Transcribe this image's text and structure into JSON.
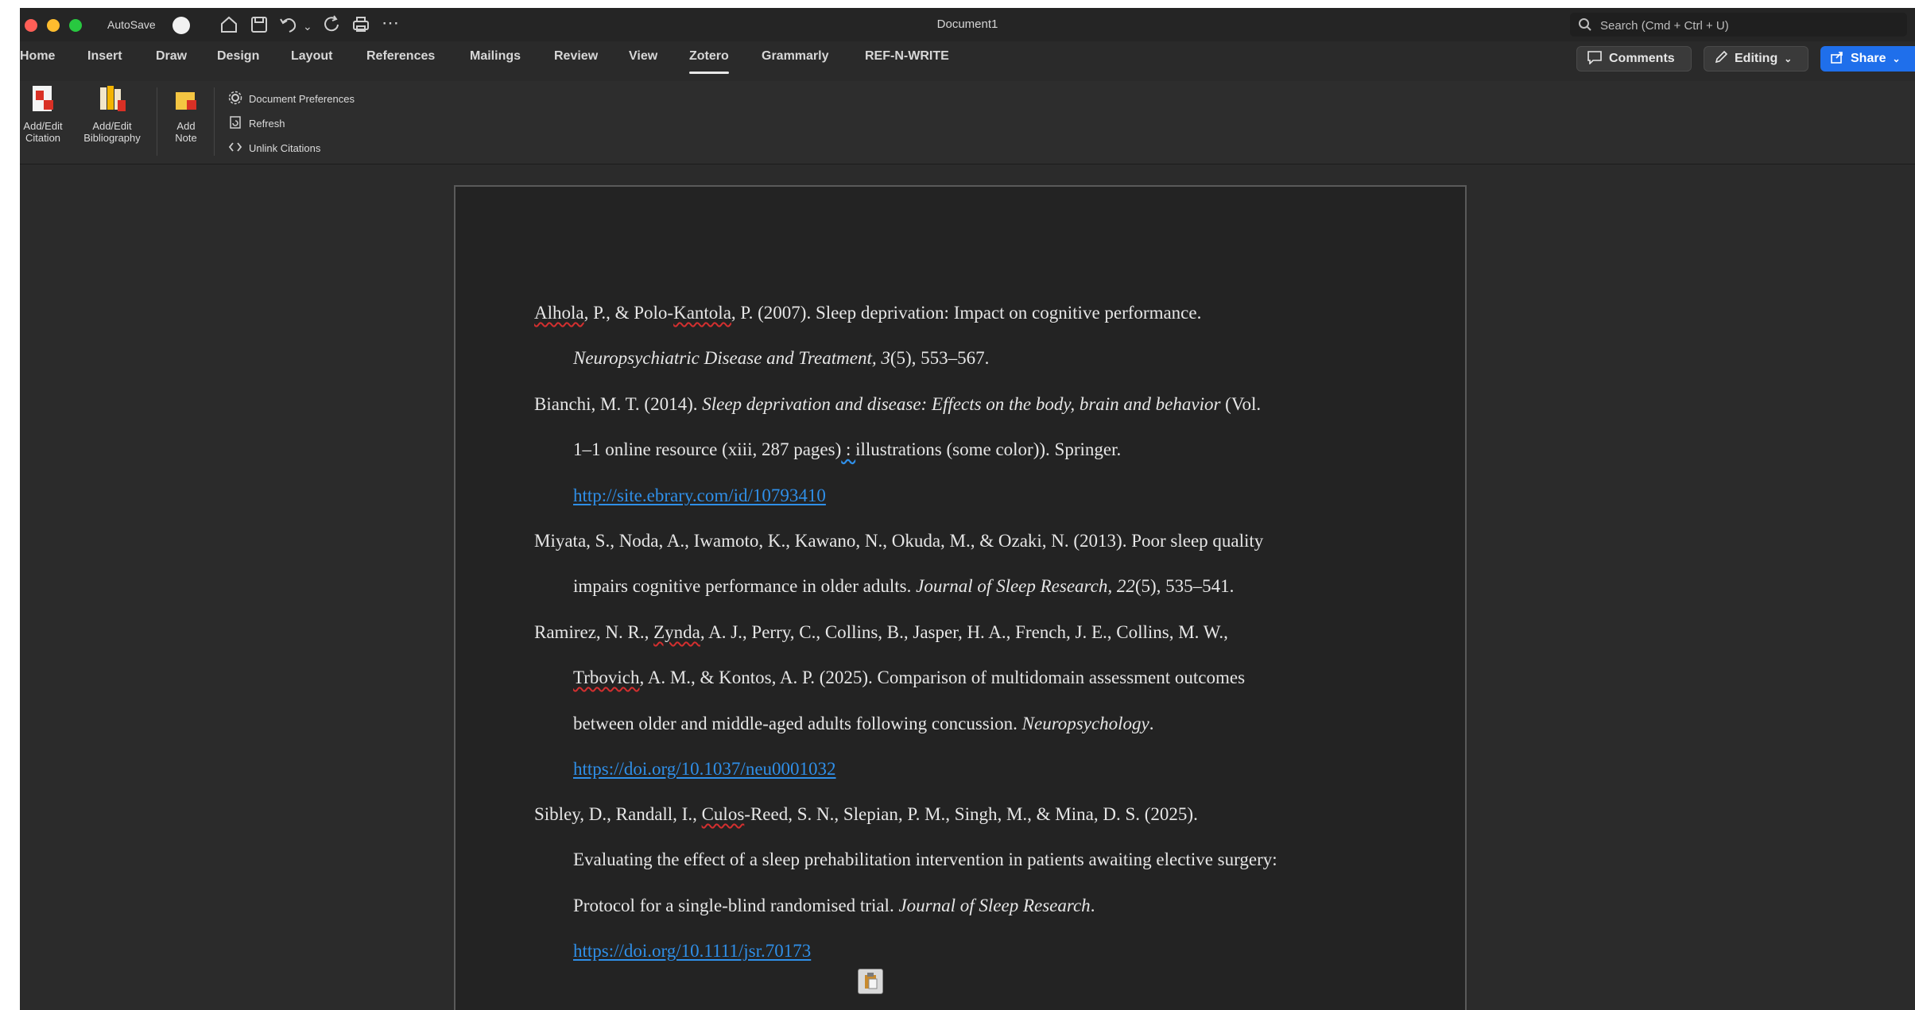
{
  "window": {
    "title": "Document1",
    "autosave_label": "AutoSave",
    "search_placeholder": "Search (Cmd + Ctrl + U)"
  },
  "tabs": [
    "Home",
    "Insert",
    "Draw",
    "Design",
    "Layout",
    "References",
    "Mailings",
    "Review",
    "View",
    "Zotero",
    "Grammarly",
    "REF-N-WRITE"
  ],
  "active_tab": "Zotero",
  "header_buttons": {
    "comments": "Comments",
    "editing": "Editing",
    "share": "Share"
  },
  "ribbon": {
    "add_edit_citation": [
      "Add/Edit",
      "Citation"
    ],
    "add_edit_bibliography": [
      "Add/Edit",
      "Bibliography"
    ],
    "add_note": [
      "Add",
      "Note"
    ],
    "document_preferences": "Document Preferences",
    "refresh": "Refresh",
    "unlink_citations": "Unlink Citations"
  },
  "references": {
    "r1": {
      "authors_a": "Alhola",
      "authors_b": ", P., & Polo-",
      "authors_c": "Kantola",
      "rest": ", P. (2007). Sleep deprivation: Impact on cognitive performance.",
      "journal": "Neuropsychiatric Disease and Treatment, 3",
      "tail": "(5), 553–567."
    },
    "r2": {
      "authors": "Bianchi, M. T. (2014). ",
      "title": "Sleep deprivation and disease: Effects on the body, brain and behavior",
      "tail1": " (Vol.",
      "line2a": "1–1 online resource (xiii, 287 pages)",
      "line2b": " : ",
      "line2c": "illustrations (some color)). Springer.",
      "url": "http://site.ebrary.com/id/10793410"
    },
    "r3": {
      "line1": "Miyata, S., Noda, A., Iwamoto, K., Kawano, N., Okuda, M., & Ozaki, N. (2013). Poor sleep quality",
      "line2a": "impairs cognitive performance in older adults. ",
      "journal": "Journal of Sleep Research, 22",
      "tail": "(5), 535–541."
    },
    "r4": {
      "l1a": "Ramirez, N. R., ",
      "l1b": "Zynda",
      "l1c": ", A. J., Perry, C., Collins, B., Jasper, H. A., French, J. E., Collins, M. W.,",
      "l2a": "Trbovich",
      "l2b": ", A. M., & Kontos, A. P. (2025). Comparison of multidomain assessment outcomes",
      "l3a": "between older and middle-aged adults following concussion. ",
      "journal": "Neuropsychology",
      "l3c": ".",
      "url": "https://doi.org/10.1037/neu0001032"
    },
    "r5": {
      "l1a": "Sibley, D., Randall, I., ",
      "l1b": "Culos",
      "l1c": "-Reed, S. N., Slepian, P. M., Singh, M., & Mina, D. S. (2025).",
      "l2": "Evaluating the effect of a sleep prehabilitation intervention in patients awaiting elective surgery:",
      "l3a": "Protocol for a single-blind randomised trial. ",
      "journal": "Journal of Sleep Research",
      "l3c": ".",
      "url": "https://doi.org/10.1111/jsr.70173"
    }
  }
}
